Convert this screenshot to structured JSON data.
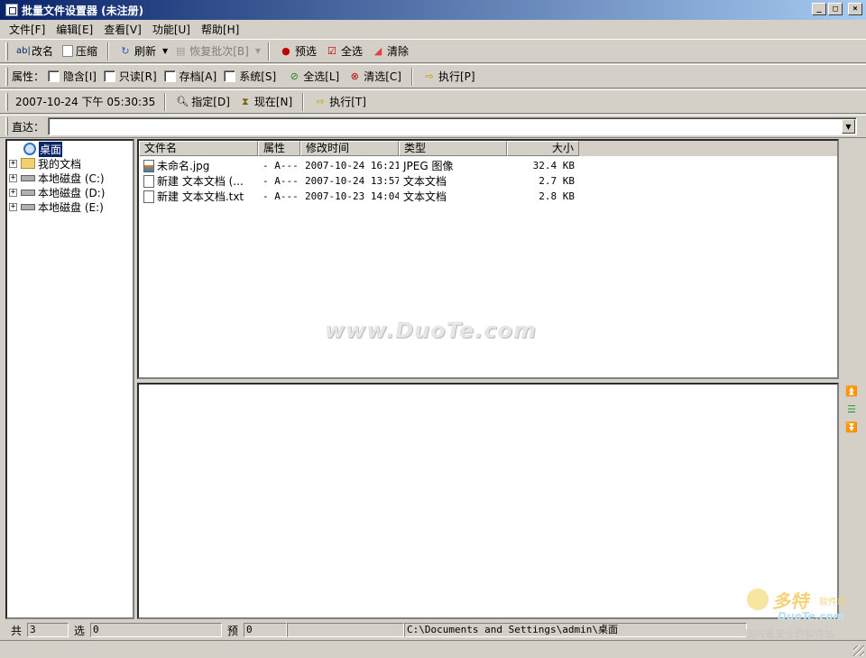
{
  "window": {
    "title": "批量文件设置器 (未注册)",
    "buttons": {
      "minimize": "_",
      "maximize": "□",
      "close": "×"
    }
  },
  "menu": [
    "文件[F]",
    "编辑[E]",
    "查看[V]",
    "功能[U]",
    "帮助[H]"
  ],
  "toolbar": {
    "rename": "改名",
    "compress": "压缩",
    "refresh": "刷新",
    "restore": "恢复批次[B]",
    "preselect": "预选",
    "select_all": "全选",
    "clear": "清除"
  },
  "attributes": {
    "label": "属性：",
    "hidden": "隐含[I]",
    "readonly": "只读[R]",
    "archive": "存档[A]",
    "system": "系统[S]",
    "select_all": "全选[L]",
    "clear": "清选[C]",
    "execute": "执行[P]"
  },
  "time": {
    "value": "2007-10-24 下午 05:30:35",
    "specify": "指定[D]",
    "now": "现在[N]",
    "execute": "执行[T]"
  },
  "address": {
    "label": "直达：",
    "value": ""
  },
  "tree": [
    {
      "label": "桌面",
      "selected": true
    },
    {
      "label": "我的文档"
    },
    {
      "label": "本地磁盘 (C:)"
    },
    {
      "label": "本地磁盘 (D:)"
    },
    {
      "label": "本地磁盘 (E:)"
    }
  ],
  "files": {
    "columns": [
      "文件名",
      "属性",
      "修改时间",
      "类型",
      "大小"
    ],
    "rows": [
      {
        "name": "未命名.jpg",
        "attr": "- A---",
        "time": "2007-10-24 16:21",
        "type": "JPEG 图像",
        "size": "32.4 KB",
        "icon": "image-file-icon"
      },
      {
        "name": "新建 文本文档 (...",
        "attr": "- A---",
        "time": "2007-10-24 13:57",
        "type": "文本文档",
        "size": "2.7 KB",
        "icon": "text-file-icon"
      },
      {
        "name": "新建 文本文档.txt",
        "attr": "- A---",
        "time": "2007-10-23 14:04",
        "type": "文本文档",
        "size": "2.8 KB",
        "icon": "text-file-icon"
      }
    ]
  },
  "watermark": "www.DuoTe.com",
  "status": {
    "total_label": "共",
    "total": "3",
    "selected_label": "选",
    "selected": "0",
    "pre_label": "预",
    "pre": "0",
    "path": "C:\\Documents and Settings\\admin\\桌面"
  },
  "logo": {
    "big": "多特",
    "small": "软件站",
    "sub": "DuoTe.com",
    "slogan": "国内最安全的软件站"
  }
}
